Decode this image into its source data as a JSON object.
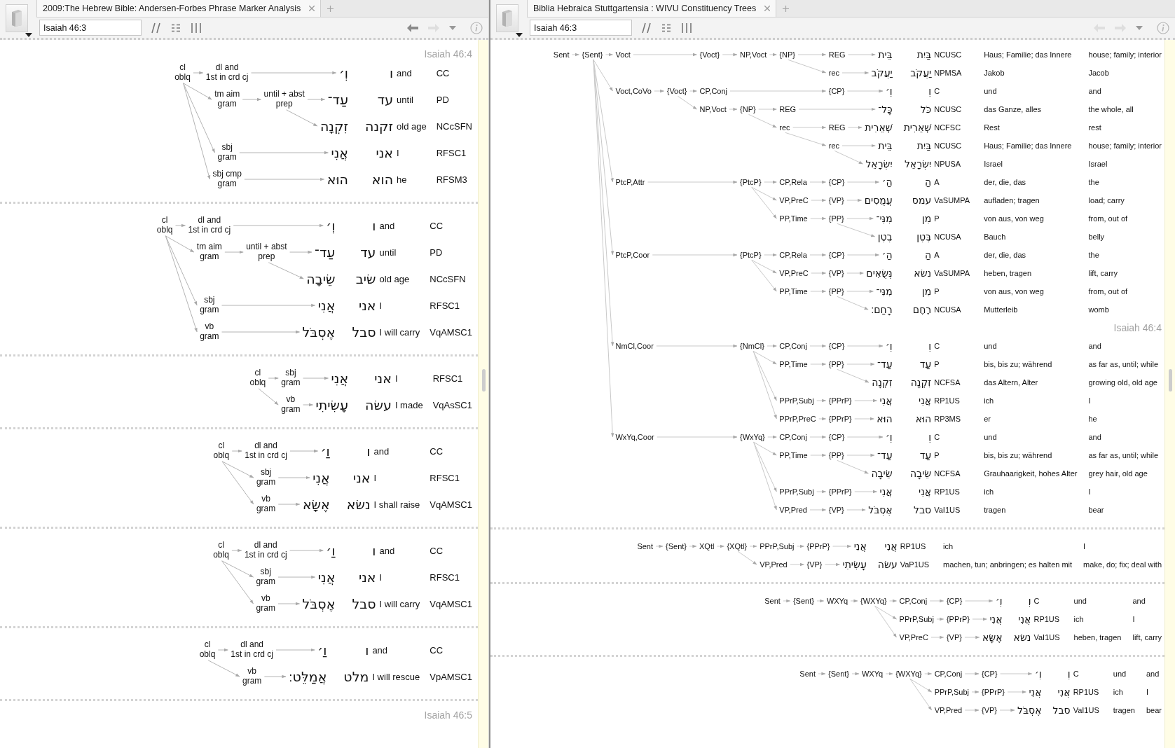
{
  "panes": [
    {
      "kind": "phrase-marker",
      "tab": {
        "title": "2009:The Hebrew Bible: Andersen-Forbes Phrase Marker Analysis"
      },
      "reference": "Isaiah 46:3",
      "nav": {
        "back_disabled": false,
        "forward_disabled": true
      },
      "blocks": [
        {
          "verse": "Isaiah 46:4",
          "tree": {
            "label": "cl\noblq",
            "children": [
              {
                "label": "dl and\n1st in crd cj",
                "words": [
                  {
                    "pointed": "וְ׳",
                    "lexeme": "ו",
                    "gloss": "and",
                    "morph": "CC"
                  }
                ]
              },
              {
                "label": "tm aim\ngram",
                "children": [
                  {
                    "label": "until + abst\nprep",
                    "words": [
                      {
                        "pointed": "עַד־",
                        "lexeme": "עד",
                        "gloss": "until",
                        "morph": "PD"
                      },
                      {
                        "pointed": "זִקְנָה",
                        "lexeme": "זקנה",
                        "gloss": "old age",
                        "morph": "NCcSFN"
                      }
                    ]
                  }
                ]
              },
              {
                "label": "sbj\ngram",
                "words": [
                  {
                    "pointed": "אֲנִי",
                    "lexeme": "אני",
                    "gloss": "I",
                    "morph": "RFSC1"
                  }
                ]
              },
              {
                "label": "sbj cmp\ngram",
                "words": [
                  {
                    "pointed": "הוּא",
                    "lexeme": "הוא",
                    "gloss": "he",
                    "morph": "RFSM3"
                  }
                ]
              }
            ]
          }
        },
        {
          "tree": {
            "label": "cl\noblq",
            "children": [
              {
                "label": "dl and\n1st in crd cj",
                "words": [
                  {
                    "pointed": "וְ׳",
                    "lexeme": "ו",
                    "gloss": "and",
                    "morph": "CC"
                  }
                ]
              },
              {
                "label": "tm aim\ngram",
                "children": [
                  {
                    "label": "until + abst\nprep",
                    "words": [
                      {
                        "pointed": "עַד־",
                        "lexeme": "עד",
                        "gloss": "until",
                        "morph": "PD"
                      },
                      {
                        "pointed": "שֵׂיבָה",
                        "lexeme": "שׂיב",
                        "gloss": "old age",
                        "morph": "NCcSFN"
                      }
                    ]
                  }
                ]
              },
              {
                "label": "sbj\ngram",
                "words": [
                  {
                    "pointed": "אֲנִי",
                    "lexeme": "אני",
                    "gloss": "I",
                    "morph": "RFSC1"
                  }
                ]
              },
              {
                "label": "vb\ngram",
                "words": [
                  {
                    "pointed": "אֶסְבֹּל",
                    "lexeme": "סבל",
                    "gloss": "I will carry",
                    "morph": "VqAMSC1"
                  }
                ]
              }
            ]
          }
        },
        {
          "tree": {
            "label": "cl\noblq",
            "children": [
              {
                "label": "sbj\ngram",
                "words": [
                  {
                    "pointed": "אֲנִי",
                    "lexeme": "אני",
                    "gloss": "I",
                    "morph": "RFSC1"
                  }
                ]
              },
              {
                "label": "vb\ngram",
                "words": [
                  {
                    "pointed": "עָשִׂיתִי",
                    "lexeme": "עשׂה",
                    "gloss": "I made",
                    "morph": "VqAsSC1"
                  }
                ]
              }
            ]
          }
        },
        {
          "tree": {
            "label": "cl\noblq",
            "children": [
              {
                "label": "dl and\n1st in crd cj",
                "words": [
                  {
                    "pointed": "וַ׳",
                    "lexeme": "ו",
                    "gloss": "and",
                    "morph": "CC"
                  }
                ]
              },
              {
                "label": "sbj\ngram",
                "words": [
                  {
                    "pointed": "אֲנִי",
                    "lexeme": "אני",
                    "gloss": "I",
                    "morph": "RFSC1"
                  }
                ]
              },
              {
                "label": "vb\ngram",
                "words": [
                  {
                    "pointed": "אֶשָּׂא",
                    "lexeme": "נשׂא",
                    "gloss": "I shall raise",
                    "morph": "VqAMSC1"
                  }
                ]
              }
            ]
          }
        },
        {
          "tree": {
            "label": "cl\noblq",
            "children": [
              {
                "label": "dl and\n1st in crd cj",
                "words": [
                  {
                    "pointed": "וַ׳",
                    "lexeme": "ו",
                    "gloss": "and",
                    "morph": "CC"
                  }
                ]
              },
              {
                "label": "sbj\ngram",
                "words": [
                  {
                    "pointed": "אֲנִי",
                    "lexeme": "אני",
                    "gloss": "I",
                    "morph": "RFSC1"
                  }
                ]
              },
              {
                "label": "vb\ngram",
                "words": [
                  {
                    "pointed": "אֶסְבֹּל",
                    "lexeme": "סבל",
                    "gloss": "I will carry",
                    "morph": "VqAMSC1"
                  }
                ]
              }
            ]
          }
        },
        {
          "tree": {
            "label": "cl\noblq",
            "children": [
              {
                "label": "dl and\n1st in crd cj",
                "words": [
                  {
                    "pointed": "וַ׳",
                    "lexeme": "ו",
                    "gloss": "and",
                    "morph": "CC"
                  }
                ]
              },
              {
                "label": "vb\ngram",
                "words": [
                  {
                    "pointed": "אֲמַלֵּט׃",
                    "lexeme": "מלט",
                    "gloss": "I will rescue",
                    "morph": "VpAMSC1"
                  }
                ]
              }
            ]
          }
        },
        {
          "verse": "Isaiah 46:5"
        }
      ]
    },
    {
      "kind": "constituency",
      "tab": {
        "title": "Biblia Hebraica Stuttgartensia : WIVU Constituency Trees"
      },
      "reference": "Isaiah 46:3",
      "nav": {
        "back_disabled": true,
        "forward_disabled": true
      },
      "blocks": [
        {
          "tree": {
            "label": "Sent",
            "children": [
              {
                "label": "{Sent}",
                "children": [
                  {
                    "label": "Voct",
                    "children": [
                      {
                        "label": "{Voct}",
                        "children": [
                          {
                            "label": "NP,Voct",
                            "children": [
                              {
                                "label": "{NP}",
                                "children": [
                                  {
                                    "label": "REG",
                                    "words": [
                                      {
                                        "pointed": "בֵּית",
                                        "lexeme": "בַּיִת",
                                        "morph": "NCUSC",
                                        "german": "Haus; Familie; das Innere",
                                        "english": "house; family; interior"
                                      }
                                    ]
                                  },
                                  {
                                    "label": "rec",
                                    "words": [
                                      {
                                        "pointed": "יַעֲקֹב",
                                        "lexeme": "יַעֲקֹב",
                                        "morph": "NPMSA",
                                        "german": "Jakob",
                                        "english": "Jacob"
                                      }
                                    ]
                                  }
                                ]
                              }
                            ]
                          }
                        ]
                      }
                    ]
                  },
                  {
                    "label": "Voct,CoVo",
                    "children": [
                      {
                        "label": "{Voct}",
                        "children": [
                          {
                            "label": "CP,Conj",
                            "children": [
                              {
                                "label": "{CP}",
                                "words": [
                                  {
                                    "pointed": "וְ׳",
                                    "lexeme": "וְ",
                                    "morph": "C",
                                    "german": "und",
                                    "english": "and"
                                  }
                                ]
                              }
                            ]
                          },
                          {
                            "label": "NP,Voct",
                            "children": [
                              {
                                "label": "{NP}",
                                "children": [
                                  {
                                    "label": "REG",
                                    "words": [
                                      {
                                        "pointed": "כָּל־",
                                        "lexeme": "כֹּל",
                                        "morph": "NCUSC",
                                        "german": "das Ganze, alles",
                                        "english": "the whole, all"
                                      }
                                    ]
                                  },
                                  {
                                    "label": "rec",
                                    "children": [
                                      {
                                        "label": "REG",
                                        "words": [
                                          {
                                            "pointed": "שְׁאֵרִית",
                                            "lexeme": "שְׁאֵרִית",
                                            "morph": "NCFSC",
                                            "german": "Rest",
                                            "english": "rest"
                                          }
                                        ]
                                      },
                                      {
                                        "label": "rec",
                                        "words": [
                                          {
                                            "pointed": "בֵּית",
                                            "lexeme": "בַּיִת",
                                            "morph": "NCUSC",
                                            "german": "Haus; Familie; das Innere",
                                            "english": "house; family; interior"
                                          },
                                          {
                                            "pointed": "יִשְׂרָאֵל",
                                            "lexeme": "יִשְׂרָאֵל",
                                            "morph": "NPUSA",
                                            "german": "Israel",
                                            "english": "Israel"
                                          }
                                        ]
                                      }
                                    ]
                                  }
                                ]
                              }
                            ]
                          }
                        ]
                      }
                    ]
                  },
                  {
                    "label": "PtcP,Attr",
                    "children": [
                      {
                        "label": "{PtcP}",
                        "children": [
                          {
                            "label": "CP,Rela",
                            "children": [
                              {
                                "label": "{CP}",
                                "words": [
                                  {
                                    "pointed": "הַ׳",
                                    "lexeme": "הַ",
                                    "morph": "A",
                                    "german": "der, die, das",
                                    "english": "the"
                                  }
                                ]
                              }
                            ]
                          },
                          {
                            "label": "VP,PreC",
                            "children": [
                              {
                                "label": "{VP}",
                                "words": [
                                  {
                                    "pointed": "עֲמֻסִים",
                                    "lexeme": "עמס",
                                    "morph": "VaSUMPA",
                                    "german": "aufladen; tragen",
                                    "english": "load; carry"
                                  }
                                ]
                              }
                            ]
                          },
                          {
                            "label": "PP,Time",
                            "children": [
                              {
                                "label": "{PP}",
                                "words": [
                                  {
                                    "pointed": "מִנִּי־",
                                    "lexeme": "מִן",
                                    "morph": "P",
                                    "german": "von aus, von weg",
                                    "english": "from, out of"
                                  },
                                  {
                                    "pointed": "בֶטֶן",
                                    "lexeme": "בֶּטֶן",
                                    "morph": "NCUSA",
                                    "german": "Bauch",
                                    "english": "belly"
                                  }
                                ]
                              }
                            ]
                          }
                        ]
                      }
                    ]
                  },
                  {
                    "label": "PtcP,Coor",
                    "children": [
                      {
                        "label": "{PtcP}",
                        "children": [
                          {
                            "label": "CP,Rela",
                            "children": [
                              {
                                "label": "{CP}",
                                "words": [
                                  {
                                    "pointed": "הַ׳",
                                    "lexeme": "הַ",
                                    "morph": "A",
                                    "german": "der, die, das",
                                    "english": "the"
                                  }
                                ]
                              }
                            ]
                          },
                          {
                            "label": "VP,PreC",
                            "children": [
                              {
                                "label": "{VP}",
                                "words": [
                                  {
                                    "pointed": "נְּשֻׂאִים",
                                    "lexeme": "נשׂא",
                                    "morph": "VaSUMPA",
                                    "german": "heben, tragen",
                                    "english": "lift, carry"
                                  }
                                ]
                              }
                            ]
                          },
                          {
                            "label": "PP,Time",
                            "children": [
                              {
                                "label": "{PP}",
                                "words": [
                                  {
                                    "pointed": "מִנִּי־",
                                    "lexeme": "מִן",
                                    "morph": "P",
                                    "german": "von aus, von weg",
                                    "english": "from, out of"
                                  },
                                  {
                                    "pointed": "רָחַם׃",
                                    "lexeme": "רֶחֶם",
                                    "morph": "NCUSA",
                                    "german": "Mutterleib",
                                    "english": "womb"
                                  }
                                ]
                              }
                            ]
                          }
                        ]
                      }
                    ]
                  },
                  {
                    "label": "NmCl,Coor",
                    "verse": "Isaiah 46:4",
                    "children": [
                      {
                        "label": "{NmCl}",
                        "children": [
                          {
                            "label": "CP,Conj",
                            "children": [
                              {
                                "label": "{CP}",
                                "words": [
                                  {
                                    "pointed": "וְ׳",
                                    "lexeme": "וְ",
                                    "morph": "C",
                                    "german": "und",
                                    "english": "and"
                                  }
                                ]
                              }
                            ]
                          },
                          {
                            "label": "PP,Time",
                            "children": [
                              {
                                "label": "{PP}",
                                "words": [
                                  {
                                    "pointed": "עַד־",
                                    "lexeme": "עַד",
                                    "morph": "P",
                                    "german": "bis, bis zu; während",
                                    "english": "as far as, until; while"
                                  },
                                  {
                                    "pointed": "זִקְנָה",
                                    "lexeme": "זִקְנָה",
                                    "morph": "NCFSA",
                                    "german": "das Altern, Alter",
                                    "english": "growing old, old age"
                                  }
                                ]
                              }
                            ]
                          },
                          {
                            "label": "PPrP,Subj",
                            "children": [
                              {
                                "label": "{PPrP}",
                                "words": [
                                  {
                                    "pointed": "אֲנִי",
                                    "lexeme": "אֲנִי",
                                    "morph": "RP1US",
                                    "german": "ich",
                                    "english": "I"
                                  }
                                ]
                              }
                            ]
                          },
                          {
                            "label": "PPrP,PreC",
                            "children": [
                              {
                                "label": "{PPrP}",
                                "words": [
                                  {
                                    "pointed": "הוּא",
                                    "lexeme": "הוּא",
                                    "morph": "RP3MS",
                                    "german": "er",
                                    "english": "he"
                                  }
                                ]
                              }
                            ]
                          }
                        ]
                      }
                    ]
                  },
                  {
                    "label": "WxYq,Coor",
                    "children": [
                      {
                        "label": "{WxYq}",
                        "children": [
                          {
                            "label": "CP,Conj",
                            "children": [
                              {
                                "label": "{CP}",
                                "words": [
                                  {
                                    "pointed": "וְ׳",
                                    "lexeme": "וְ",
                                    "morph": "C",
                                    "german": "und",
                                    "english": "and"
                                  }
                                ]
                              }
                            ]
                          },
                          {
                            "label": "PP,Time",
                            "children": [
                              {
                                "label": "{PP}",
                                "words": [
                                  {
                                    "pointed": "עַד־",
                                    "lexeme": "עַד",
                                    "morph": "P",
                                    "german": "bis, bis zu; während",
                                    "english": "as far as, until; while"
                                  },
                                  {
                                    "pointed": "שֵׂיבָה",
                                    "lexeme": "שֵׂיבָה",
                                    "morph": "NCFSA",
                                    "german": "Grauhaarigkeit, hohes Alter",
                                    "english": "grey hair, old age"
                                  }
                                ]
                              }
                            ]
                          },
                          {
                            "label": "PPrP,Subj",
                            "children": [
                              {
                                "label": "{PPrP}",
                                "words": [
                                  {
                                    "pointed": "אֲנִי",
                                    "lexeme": "אֲנִי",
                                    "morph": "RP1US",
                                    "german": "ich",
                                    "english": "I"
                                  }
                                ]
                              }
                            ]
                          },
                          {
                            "label": "VP,Pred",
                            "children": [
                              {
                                "label": "{VP}",
                                "words": [
                                  {
                                    "pointed": "אֶסְבֹּל",
                                    "lexeme": "סבל",
                                    "morph": "VaI1US",
                                    "german": "tragen",
                                    "english": "bear"
                                  }
                                ]
                              }
                            ]
                          }
                        ]
                      }
                    ]
                  }
                ]
              }
            ]
          }
        },
        {
          "tree": {
            "label": "Sent",
            "children": [
              {
                "label": "{Sent}",
                "children": [
                  {
                    "label": "XQtl",
                    "children": [
                      {
                        "label": "{XQtl}",
                        "children": [
                          {
                            "label": "PPrP,Subj",
                            "children": [
                              {
                                "label": "{PPrP}",
                                "words": [
                                  {
                                    "pointed": "אֲנִי",
                                    "lexeme": "אֲנִי",
                                    "morph": "RP1US",
                                    "german": "ich",
                                    "english": "I"
                                  }
                                ]
                              }
                            ]
                          },
                          {
                            "label": "VP,Pred",
                            "children": [
                              {
                                "label": "{VP}",
                                "words": [
                                  {
                                    "pointed": "עָשִׂיתִי",
                                    "lexeme": "עשׂה",
                                    "morph": "VaP1US",
                                    "german": "machen, tun; anbringen; es halten mit",
                                    "english": "make, do; fix; deal with"
                                  }
                                ]
                              }
                            ]
                          }
                        ]
                      }
                    ]
                  }
                ]
              }
            ]
          }
        },
        {
          "tree": {
            "label": "Sent",
            "children": [
              {
                "label": "{Sent}",
                "children": [
                  {
                    "label": "WXYq",
                    "children": [
                      {
                        "label": "{WXYq}",
                        "children": [
                          {
                            "label": "CP,Conj",
                            "children": [
                              {
                                "label": "{CP}",
                                "words": [
                                  {
                                    "pointed": "וְ׳",
                                    "lexeme": "וְ",
                                    "morph": "C",
                                    "german": "und",
                                    "english": "and"
                                  }
                                ]
                              }
                            ]
                          },
                          {
                            "label": "PPrP,Subj",
                            "children": [
                              {
                                "label": "{PPrP}",
                                "words": [
                                  {
                                    "pointed": "אֲנִי",
                                    "lexeme": "אֲנִי",
                                    "morph": "RP1US",
                                    "german": "ich",
                                    "english": "I"
                                  }
                                ]
                              }
                            ]
                          },
                          {
                            "label": "VP,PreC",
                            "children": [
                              {
                                "label": "{VP}",
                                "words": [
                                  {
                                    "pointed": "אֶשָּׂא",
                                    "lexeme": "נשׂא",
                                    "morph": "VaI1US",
                                    "german": "heben, tragen",
                                    "english": "lift, carry"
                                  }
                                ]
                              }
                            ]
                          }
                        ]
                      }
                    ]
                  }
                ]
              }
            ]
          }
        },
        {
          "tree": {
            "label": "Sent",
            "children": [
              {
                "label": "{Sent}",
                "children": [
                  {
                    "label": "WXYq",
                    "children": [
                      {
                        "label": "{WXYq}",
                        "children": [
                          {
                            "label": "CP,Conj",
                            "children": [
                              {
                                "label": "{CP}",
                                "words": [
                                  {
                                    "pointed": "וְ׳",
                                    "lexeme": "וְ",
                                    "morph": "C",
                                    "german": "und",
                                    "english": "and"
                                  }
                                ]
                              }
                            ]
                          },
                          {
                            "label": "PPrP,Subj",
                            "children": [
                              {
                                "label": "{PPrP}",
                                "words": [
                                  {
                                    "pointed": "אֲנִי",
                                    "lexeme": "אֲנִי",
                                    "morph": "RP1US",
                                    "german": "ich",
                                    "english": "I"
                                  }
                                ]
                              }
                            ]
                          },
                          {
                            "label": "VP,Pred",
                            "children": [
                              {
                                "label": "{VP}",
                                "words": [
                                  {
                                    "pointed": "אֶסְבֹּל",
                                    "lexeme": "סבל",
                                    "morph": "VaI1US",
                                    "german": "tragen",
                                    "english": "bear"
                                  }
                                ]
                              }
                            ]
                          }
                        ]
                      }
                    ]
                  }
                ]
              }
            ]
          }
        }
      ]
    }
  ]
}
